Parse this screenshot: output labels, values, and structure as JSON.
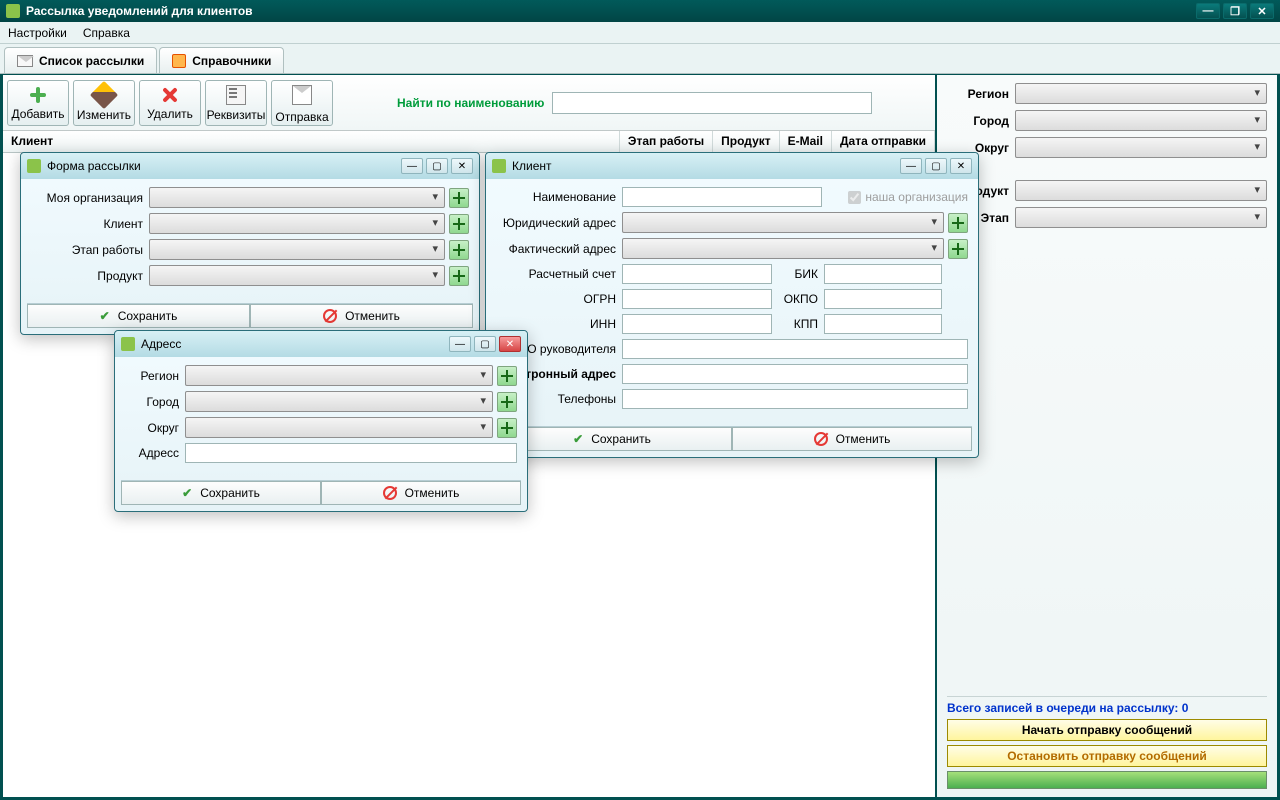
{
  "app_title": "Рассылка уведомлений для клиентов",
  "menu": {
    "settings": "Настройки",
    "help": "Справка"
  },
  "tabs": {
    "list": "Список рассылки",
    "refs": "Справочники"
  },
  "toolbar": {
    "add": "Добавить",
    "edit": "Изменить",
    "del": "Удалить",
    "req": "Реквизиты",
    "send": "Отправка"
  },
  "search_label": "Найти по наименованию",
  "grid": {
    "client": "Клиент",
    "stage": "Этап работы",
    "product": "Продукт",
    "email": "E-Mail",
    "sent": "Дата отправки"
  },
  "filters": {
    "region": "Регион",
    "city": "Город",
    "district": "Округ",
    "product": "Продукт",
    "stage": "Этап"
  },
  "queue_label": "Всего записей в очереди на рассылку: ",
  "queue_count": "0",
  "start_btn": "Начать отправку сообщений",
  "stop_btn": "Остановить отправку сообщений",
  "dlg_form": {
    "title": "Форма рассылки",
    "org": "Моя организация",
    "client": "Клиент",
    "stage": "Этап работы",
    "product": "Продукт"
  },
  "dlg_client": {
    "title": "Клиент",
    "name": "Наименование",
    "our_org": "наша организация",
    "legal_addr": "Юридический адрес",
    "actual_addr": "Фактический адрес",
    "account": "Расчетный счет",
    "bik": "БИК",
    "ogrn": "ОГРН",
    "okpo": "ОКПО",
    "inn": "ИНН",
    "kpp": "КПП",
    "fio": "ФИО руководителя",
    "email": "Электронный адрес",
    "phones": "Телефоны"
  },
  "dlg_addr": {
    "title": "Адресс",
    "region": "Регион",
    "city": "Город",
    "district": "Округ",
    "address": "Адресс"
  },
  "btn": {
    "save": "Сохранить",
    "cancel": "Отменить"
  }
}
